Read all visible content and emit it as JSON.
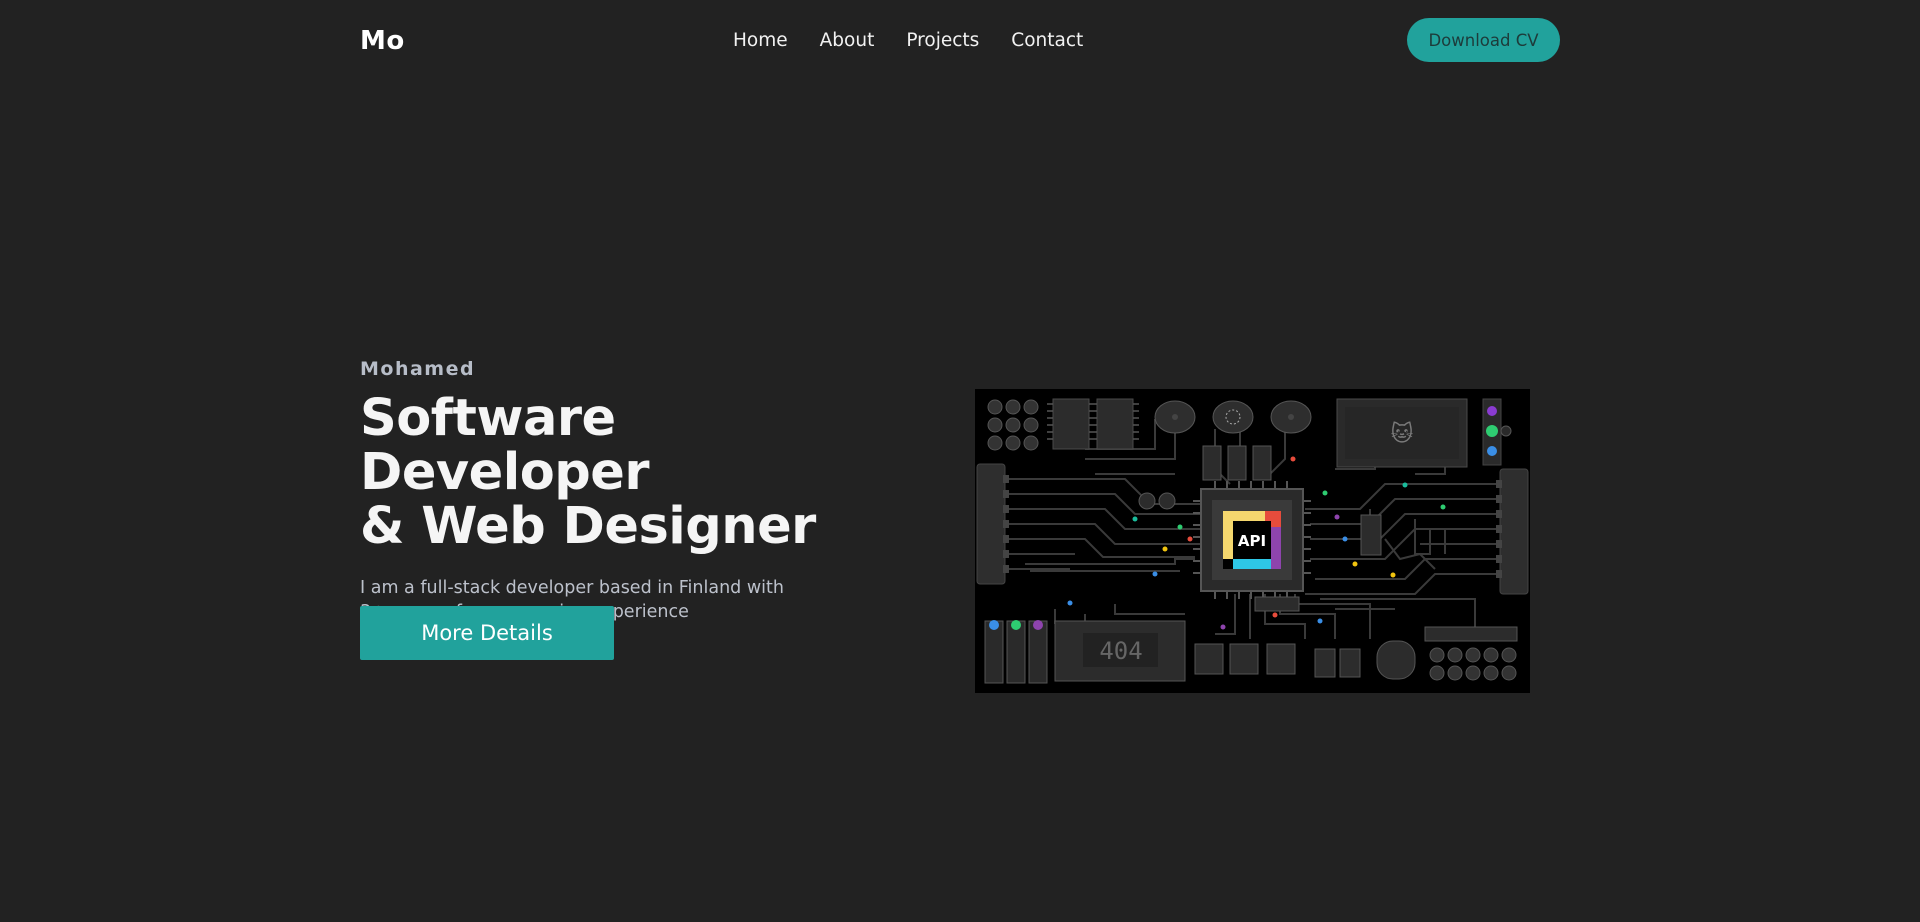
{
  "nav": {
    "logo": "Mo",
    "links": [
      "Home",
      "About",
      "Projects",
      "Contact"
    ],
    "cv_button": "Download CV"
  },
  "hero": {
    "eyebrow": "Mohamed",
    "headline_line1": "Software Developer",
    "headline_line2": "& Web Designer",
    "subtitle_line1": "I am a full-stack developer based in Finland with",
    "subtitle_line2": "3+ years of programming experience",
    "cta": "More Details"
  },
  "illustration": {
    "chip_label": "API",
    "display_text": "404",
    "icon": "cat-icon"
  },
  "colors": {
    "background": "#222222",
    "accent": "#21a29c"
  }
}
